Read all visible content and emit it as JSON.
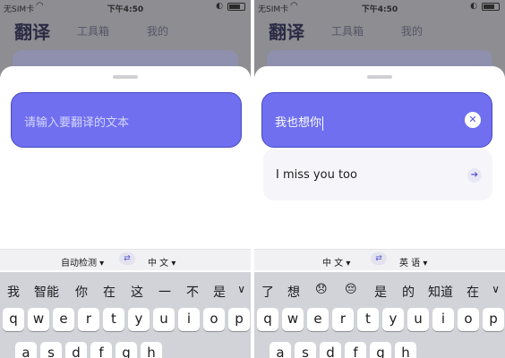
{
  "left": {
    "status": {
      "carrier": "无SIM卡",
      "wifi_icon": "wifi-icon",
      "time": "下午4:50"
    },
    "nav": {
      "title": "翻译",
      "tabs": [
        "工具箱",
        "我的"
      ]
    },
    "input": {
      "placeholder": "请输入要翻译的文本",
      "value": ""
    },
    "languages": {
      "source": "自动检测 ▾",
      "target": "中 文 ▾",
      "swap_icon": "swap-icon"
    },
    "candidates": [
      "我",
      "智能",
      "你",
      "在",
      "这",
      "一",
      "不",
      "是"
    ],
    "keys": [
      "q",
      "w",
      "e",
      "r",
      "t",
      "y",
      "u",
      "i",
      "o",
      "p"
    ],
    "keys_row2": [
      "a",
      "s",
      "d",
      "f",
      "g",
      "h"
    ]
  },
  "right": {
    "status": {
      "carrier": "无SIM卡",
      "wifi_icon": "wifi-icon",
      "time": "下午4:50"
    },
    "nav": {
      "title": "翻译",
      "tabs": [
        "工具箱",
        "我的"
      ]
    },
    "input": {
      "value": "我也想你"
    },
    "result": {
      "text": "I miss you too"
    },
    "languages": {
      "source": "中 文 ▾",
      "target": "英 语 ▾",
      "swap_icon": "swap-icon"
    },
    "candidates": [
      "了",
      "想",
      "😞",
      "😔",
      "是",
      "的",
      "知道",
      "在"
    ],
    "keys": [
      "q",
      "w",
      "e",
      "r",
      "t",
      "y",
      "u",
      "i",
      "o",
      "p"
    ],
    "keys_row2": [
      "a",
      "s",
      "d",
      "f",
      "g",
      "h"
    ]
  },
  "colors": {
    "accent": "#6f6ff0",
    "keyboard": "#d1d3d9"
  }
}
